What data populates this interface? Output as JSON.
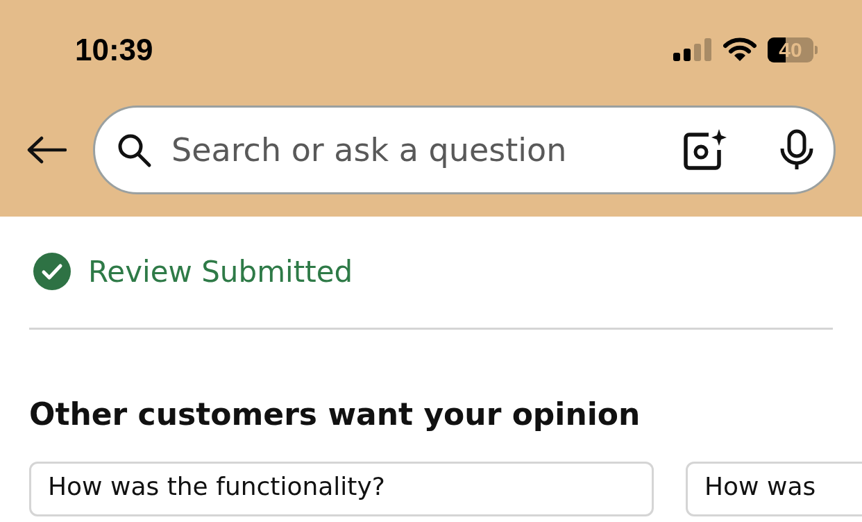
{
  "status_bar": {
    "time": "10:39",
    "battery": {
      "label": "40",
      "level": 0.4
    }
  },
  "search": {
    "placeholder": "Search or ask a question"
  },
  "confirmation": {
    "text": "Review Submitted"
  },
  "section": {
    "title": "Other customers want your opinion"
  },
  "cards": [
    {
      "question": "How was the functionality?"
    },
    {
      "question": "How was"
    }
  ]
}
